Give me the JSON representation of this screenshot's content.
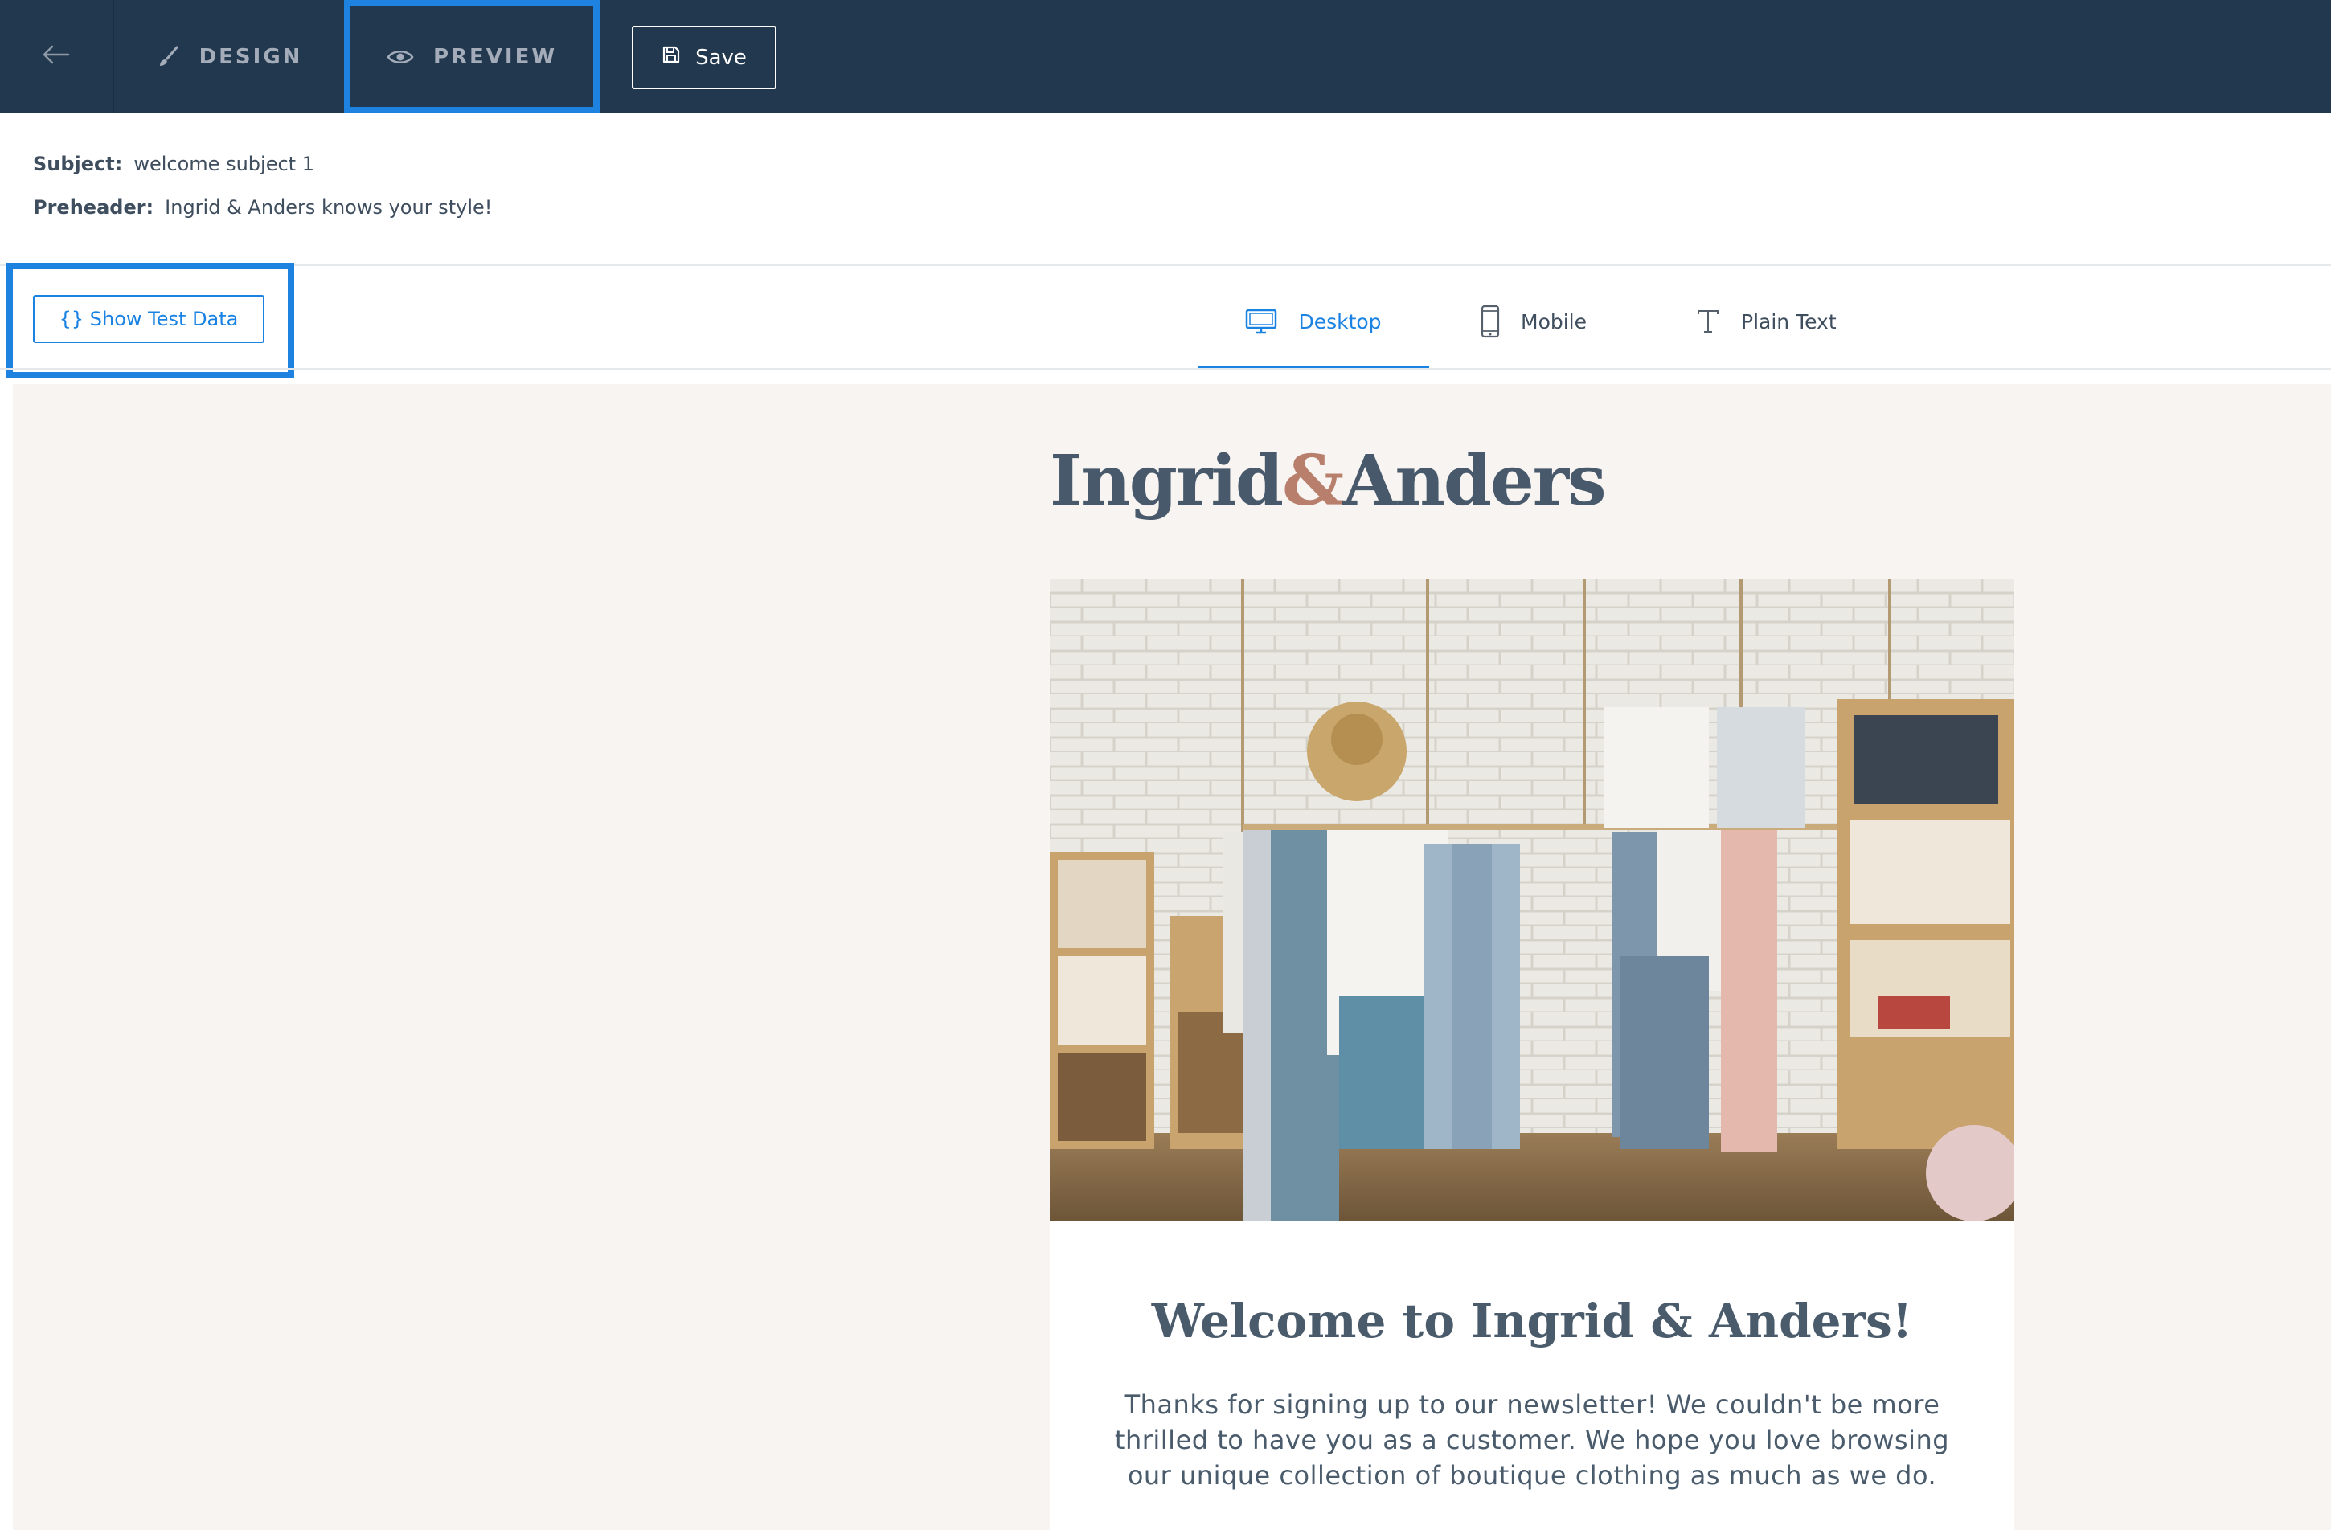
{
  "topbar": {
    "back_icon": "arrow-left-icon",
    "tabs": [
      {
        "label": "DESIGN",
        "icon": "brush-icon"
      },
      {
        "label": "PREVIEW",
        "icon": "eye-icon"
      }
    ],
    "save_label": "Save",
    "save_icon": "floppy-disk-icon",
    "bg_color": "#22384f",
    "highlight_color": "#1e82e0"
  },
  "meta": {
    "subject_label": "Subject:",
    "subject_value": "welcome subject 1",
    "preheader_label": "Preheader:",
    "preheader_value": "Ingrid & Anders knows your style!"
  },
  "toolbar": {
    "show_test_data_label": "{} Show Test Data",
    "view_tabs": [
      {
        "label": "Desktop",
        "icon": "monitor-icon",
        "active": true
      },
      {
        "label": "Mobile",
        "icon": "phone-icon",
        "active": false
      },
      {
        "label": "Plain Text",
        "icon": "text-icon",
        "active": false
      }
    ],
    "accent_color": "#1a82e2"
  },
  "email": {
    "logo_left": "Ingrid",
    "logo_amp": "&",
    "logo_right": "Anders",
    "hero_image": "boutique-clothing-rack-photo",
    "title": "Welcome to Ingrid & Anders!",
    "body": "Thanks for signing up to our newsletter! We couldn't be more thrilled to have you as a customer. We hope you love browsing our unique collection of boutique clothing as much as we do.",
    "canvas_color": "#f8f4f1"
  }
}
